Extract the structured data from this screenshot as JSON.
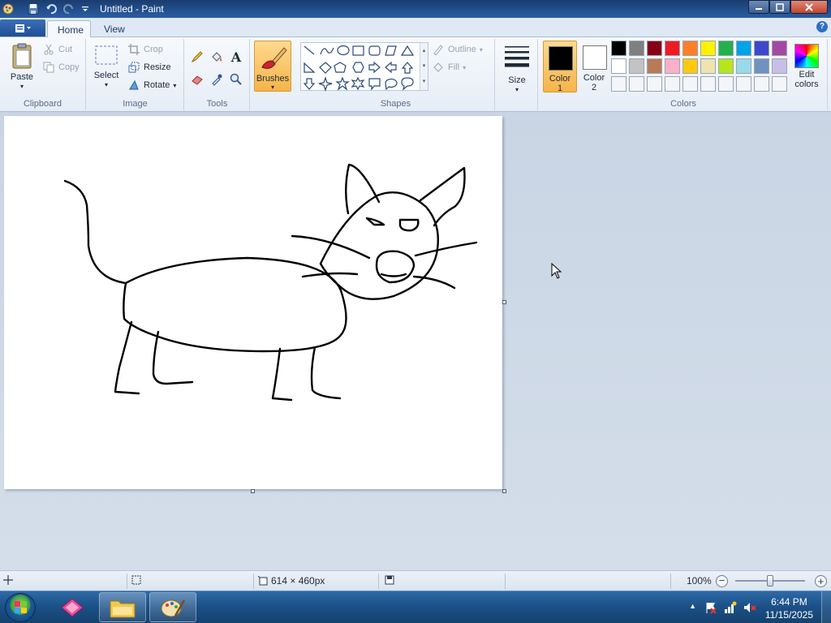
{
  "window": {
    "title": "Untitled - Paint"
  },
  "tabs": {
    "home": "Home",
    "view": "View"
  },
  "clipboard": {
    "paste": "Paste",
    "cut": "Cut",
    "copy": "Copy",
    "group_label": "Clipboard"
  },
  "image": {
    "select": "Select",
    "crop": "Crop",
    "resize": "Resize",
    "rotate": "Rotate",
    "group_label": "Image"
  },
  "tools": {
    "group_label": "Tools",
    "text_tool": "A"
  },
  "brushes": {
    "label": "Brushes"
  },
  "shapes": {
    "outline": "Outline",
    "fill": "Fill",
    "group_label": "Shapes"
  },
  "size": {
    "label": "Size"
  },
  "colors": {
    "color1_label": "Color",
    "color1_num": "1",
    "color2_label": "Color",
    "color2_num": "2",
    "edit_label": "Edit",
    "edit_label2": "colors",
    "group_label": "Colors",
    "color1_value": "#000000",
    "color2_value": "#ffffff",
    "palette_row1": [
      "#000000",
      "#7f7f7f",
      "#880015",
      "#ed1c24",
      "#ff7f27",
      "#fff200",
      "#22b14c",
      "#00a2e8",
      "#3f48cc",
      "#a349a4"
    ],
    "palette_row2": [
      "#ffffff",
      "#c3c3c3",
      "#b97a57",
      "#ffaec9",
      "#ffc90e",
      "#efe4b0",
      "#b5e61d",
      "#99d9ea",
      "#7092be",
      "#c8bfe7"
    ],
    "palette_row3": [
      "#f3f5f9",
      "#f3f5f9",
      "#f3f5f9",
      "#f3f5f9",
      "#f3f5f9",
      "#f3f5f9",
      "#f3f5f9",
      "#f3f5f9",
      "#f3f5f9",
      "#f3f5f9"
    ]
  },
  "statusbar": {
    "canvas_size": "614 × 460px",
    "zoom": "100%"
  },
  "taskbar": {
    "time": "6:44 PM",
    "date": "11/15/2025"
  }
}
